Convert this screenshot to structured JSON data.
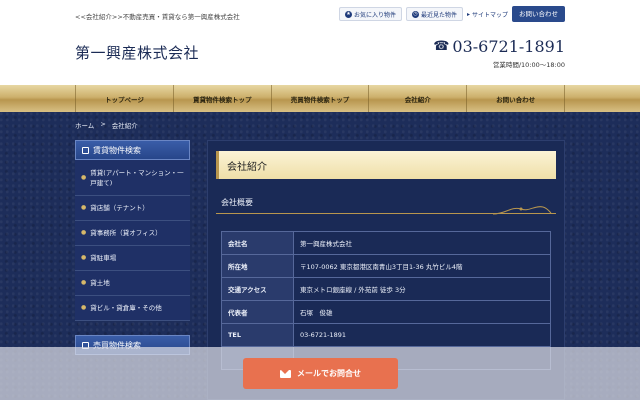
{
  "header": {
    "tagline": "<<会社紹介>>不動産売買・賃貸なら第一興産株式会社",
    "favorites_label": "お気に入り物件",
    "recent_label": "最近見た物件",
    "sitemap_label": "サイトマップ",
    "contact_label": "お問い合わせ",
    "company_name": "第一興産株式会社",
    "phone": "03-6721-1891",
    "hours": "営業時間/10:00〜18:00"
  },
  "nav": {
    "items": [
      "トップページ",
      "賃貸物件検索トップ",
      "売買物件検索トップ",
      "会社紹介",
      "お問い合わせ"
    ]
  },
  "breadcrumb": {
    "home": "ホーム",
    "separator": ">",
    "current": "会社紹介"
  },
  "sidebar": {
    "heading": "賃貸物件検索",
    "items": [
      "賃貸(アパート・マンション・一戸建て)",
      "貸店舗（テナント）",
      "貸事務所（貸オフィス）",
      "貸駐車場",
      "貸土地",
      "貸ビル・貸倉庫・その他"
    ],
    "heading2": "売買物件検索"
  },
  "main": {
    "title": "会社紹介",
    "subtitle": "会社概要",
    "rows": [
      {
        "key": "会社名",
        "value": "第一興産株式会社"
      },
      {
        "key": "所在地",
        "value": "〒107-0062 東京都港区南青山3丁目1-36 丸竹ビル4階"
      },
      {
        "key": "交通アクセス",
        "value": "東京メトロ銀座線 / 外苑前 徒歩 3分"
      },
      {
        "key": "代表者",
        "value": "石塚　俊雄"
      },
      {
        "key": "TEL",
        "value": "03-6721-1891"
      },
      {
        "key": "",
        "value": ""
      }
    ]
  },
  "footer_cta": {
    "mail_label": "メールでお問合せ"
  },
  "colors": {
    "navy": "#1d2d5a",
    "gold": "#cdb06c",
    "cta": "#e8714f"
  }
}
